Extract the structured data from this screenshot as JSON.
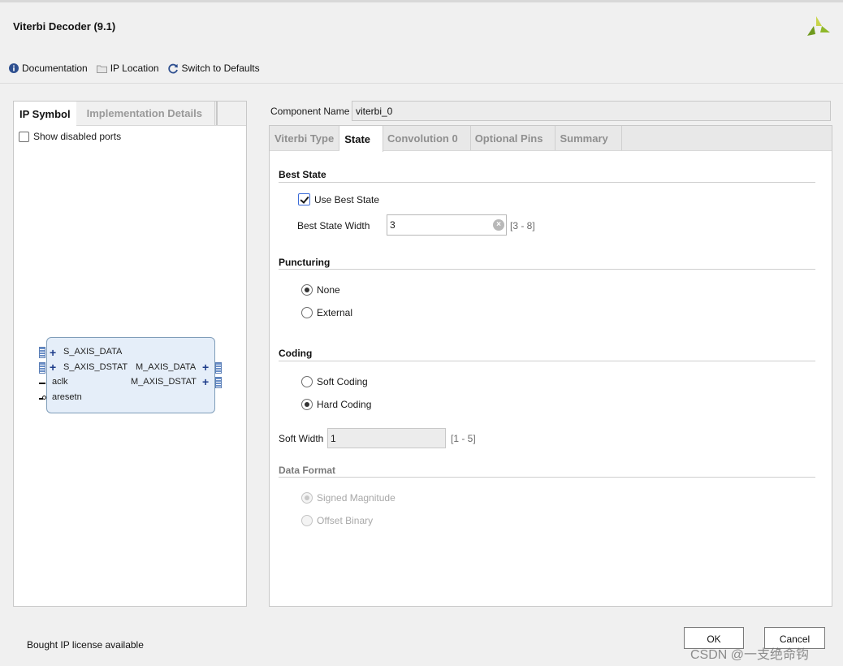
{
  "window": {
    "title": "Viterbi Decoder (9.1)"
  },
  "toolbar": {
    "documentation": "Documentation",
    "ip_location": "IP Location",
    "switch_defaults": "Switch to Defaults"
  },
  "left": {
    "tabs": [
      "IP Symbol",
      "Implementation Details"
    ],
    "show_disabled_ports": "Show disabled ports",
    "ports": {
      "s_axis_data": "S_AXIS_DATA",
      "s_axis_dstat": "S_AXIS_DSTAT",
      "aclk": "aclk",
      "aresetn": "aresetn",
      "m_axis_data": "M_AXIS_DATA",
      "m_axis_dstat": "M_AXIS_DSTAT"
    }
  },
  "component": {
    "label": "Component Name",
    "value": "viterbi_0"
  },
  "right": {
    "tabs": [
      "Viterbi Type",
      "State",
      "Convolution 0",
      "Optional Pins",
      "Summary"
    ],
    "best_state": {
      "heading": "Best State",
      "use_label": "Use Best State",
      "width_label": "Best State Width",
      "width_value": "3",
      "range": "[3 - 8]"
    },
    "puncturing": {
      "heading": "Puncturing",
      "none": "None",
      "external": "External"
    },
    "coding": {
      "heading": "Coding",
      "soft": "Soft Coding",
      "hard": "Hard Coding",
      "soft_width_label": "Soft Width",
      "soft_width_value": "1",
      "range": "[1 - 5]"
    },
    "data_format": {
      "heading": "Data Format",
      "signed": "Signed Magnitude",
      "offset": "Offset Binary"
    }
  },
  "footer": {
    "status": "Bought IP license available",
    "ok": "OK",
    "cancel": "Cancel"
  },
  "watermark": "CSDN @一支绝命钩",
  "colors": {
    "accent": "#3b6bd8",
    "symbol_fill": "#e5eef9",
    "logo": "#9fbf2f"
  }
}
